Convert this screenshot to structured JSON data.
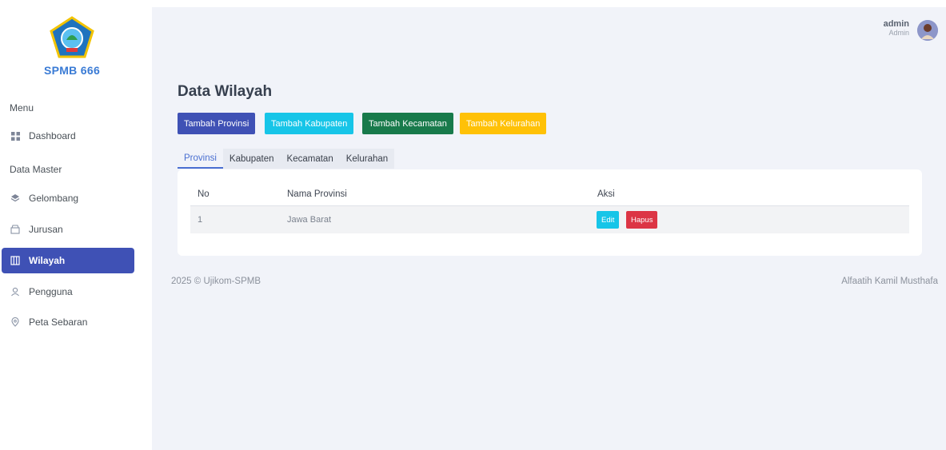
{
  "brand": {
    "name": "SPMB 666"
  },
  "sidebar": {
    "sections": [
      {
        "title": "Menu"
      },
      {
        "title": "Data Master"
      }
    ],
    "items": [
      {
        "label": "Dashboard",
        "icon": "grid-icon"
      },
      {
        "label": "Gelombang",
        "icon": "layers-icon"
      },
      {
        "label": "Jurusan",
        "icon": "box-icon"
      },
      {
        "label": "Wilayah",
        "icon": "map-icon",
        "active": true
      },
      {
        "label": "Pengguna",
        "icon": "user-icon"
      },
      {
        "label": "Peta Sebaran",
        "icon": "map-pin-icon"
      }
    ]
  },
  "header": {
    "username": "admin",
    "role": "Admin"
  },
  "main": {
    "title": "Data Wilayah",
    "buttons": {
      "add_provinsi": "Tambah Provinsi",
      "add_kabupaten": "Tambah Kabupaten",
      "add_kecamatan": "Tambah Kecamatan",
      "add_kelurahan": "Tambah Kelurahan"
    },
    "tabs": [
      "Provinsi",
      "Kabupaten",
      "Kecamatan",
      "Kelurahan"
    ],
    "table": {
      "columns": [
        "No",
        "Nama Provinsi",
        "Aksi"
      ],
      "rows": [
        {
          "no": "1",
          "nama": "Jawa Barat",
          "edit": "Edit",
          "hapus": "Hapus"
        }
      ]
    }
  },
  "footer": {
    "copyright": "2025 © Ujikom-SPMB",
    "author": "Alfaatih Kamil Musthafa"
  },
  "colors": {
    "primary": "#3f51b5",
    "info": "#17c5e8",
    "success": "#187a4b",
    "warning": "#ffc107",
    "danger": "#dc3545"
  }
}
